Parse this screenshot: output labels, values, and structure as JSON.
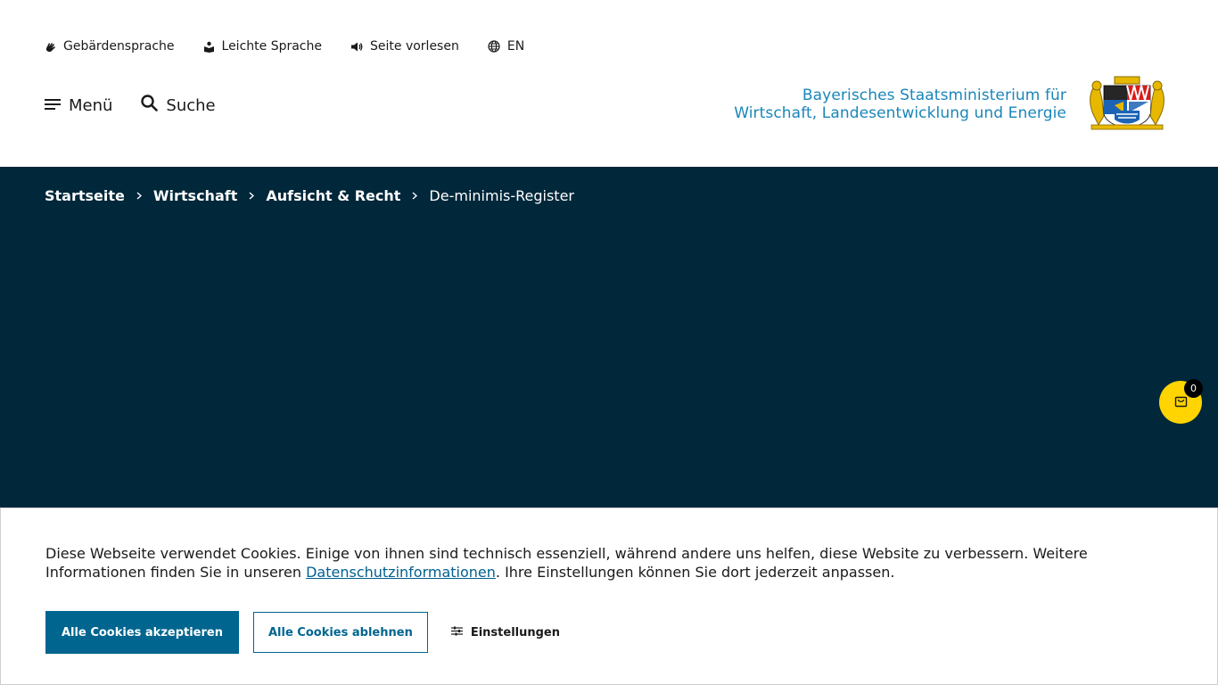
{
  "utility_nav": [
    {
      "label": "Gebärdensprache",
      "icon": "sign-language-icon"
    },
    {
      "label": "Leichte Sprache",
      "icon": "easy-language-icon"
    },
    {
      "label": "Seite vorlesen",
      "icon": "speaker-icon"
    },
    {
      "label": "EN",
      "icon": "globe-icon"
    }
  ],
  "main_nav": {
    "menu_label": "Menü",
    "search_label": "Suche"
  },
  "brand": {
    "line1": "Bayerisches Staatsministerium für",
    "line2": "Wirtschaft, Landesentwicklung und Energie",
    "logo": "bavarian-coat-of-arms"
  },
  "breadcrumb": [
    "Startseite",
    "Wirtschaft",
    "Aufsicht & Recht",
    "De-minimis-Register"
  ],
  "cart": {
    "count": "0",
    "icon": "shopping-bag-icon"
  },
  "cookie": {
    "text_before": "Diese Webseite verwendet Cookies. Einige von ihnen sind technisch essenziell, während andere uns helfen, diese Website zu verbessern. Weitere Informationen finden Sie in unseren ",
    "link": "Datenschutzinformationen",
    "text_after": ". Ihre Einstellungen können Sie dort jederzeit anpassen.",
    "accept_label": "Alle Cookies akzeptieren",
    "reject_label": "Alle Cookies ablehnen",
    "settings_label": "Einstellungen"
  },
  "colors": {
    "hero_bg": "#00273a",
    "brand_blue": "#1a86b9",
    "button_blue": "#00658f",
    "cart_yellow": "#ffd400"
  }
}
